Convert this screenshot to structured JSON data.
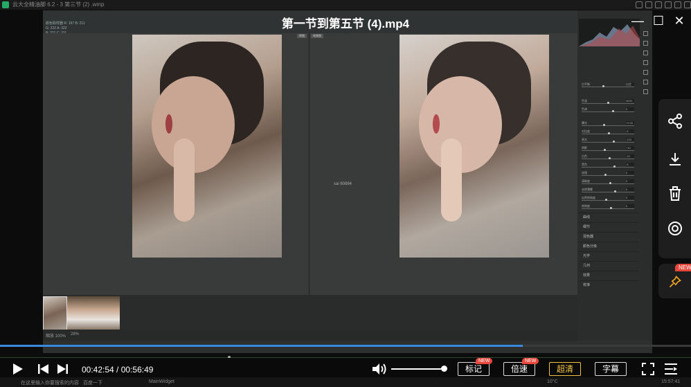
{
  "window": {
    "title": "云大全精油脚 6.2 - 3 第三节 (2) .wmp",
    "player_title": "第一节到第五节 (4).mp4"
  },
  "photoshop": {
    "info_lines": [
      "颜色取样器 R: 197 B: 211",
      "G: 222 A: 322",
      "B: 221 C: 211"
    ],
    "view_buttons": [
      "原图",
      "效果图"
    ],
    "center_label": "sai 60884",
    "status": "缩放 100%",
    "zoom": "28%",
    "panel": {
      "rows": [
        {
          "label": "白平衡",
          "value": "自定"
        },
        {
          "label": "色温",
          "value": "4600"
        },
        {
          "label": "色调",
          "value": "0"
        },
        {
          "label": "曝光",
          "value": "+0.00"
        },
        {
          "label": "对比度",
          "value": "-5"
        },
        {
          "label": "高光",
          "value": "-100"
        },
        {
          "label": "阴影",
          "value": "+10"
        },
        {
          "label": "白色",
          "value": "-15"
        },
        {
          "label": "黑色",
          "value": "-5"
        },
        {
          "label": "纹理",
          "value": "0"
        },
        {
          "label": "清晰度",
          "value": "0"
        },
        {
          "label": "去除薄雾",
          "value": "0"
        },
        {
          "label": "自然饱和度",
          "value": "0"
        },
        {
          "label": "饱和度",
          "value": "0"
        }
      ],
      "sections": [
        "曲线",
        "细节",
        "混色器",
        "颜色分级",
        "光学",
        "几何",
        "效果",
        "校准"
      ]
    }
  },
  "sidebar": {
    "share": "share-icon",
    "download": "download-icon",
    "delete": "trash-icon",
    "target": "target-icon",
    "pin": "pin-icon",
    "pin_badge": "NEW"
  },
  "controls": {
    "progress": 0.757,
    "current_time": "00:42:54",
    "total_time": "00:56:49",
    "separator": " / ",
    "volume": 0.95,
    "mark_label": "标记",
    "mark_badge": "NEW",
    "speed_label": "倍速",
    "speed_badge": "NEW",
    "quality_label": "超清",
    "subtitle_label": "字幕",
    "colors": {
      "progress": "#3a8be0",
      "badge": "#e8463a",
      "quality": "#f5c542"
    }
  },
  "taskbar": {
    "items": [
      "在这里输入你要搜索的内容",
      "百度一下",
      "MainWidget"
    ],
    "weather": "10°C",
    "clock": "15:57:41"
  }
}
